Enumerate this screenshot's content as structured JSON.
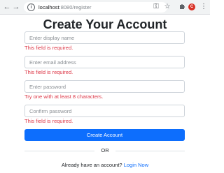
{
  "browser": {
    "url_host": "localhost",
    "url_rest": ":8080/register",
    "back_glyph": "←",
    "forward_glyph": "→",
    "reload_glyph": "↻",
    "info_glyph": "i",
    "key_glyph": "⚿",
    "star_glyph": "☆",
    "extension_glyph": "C",
    "menu_glyph": "⋮",
    "icons": [
      "back-icon",
      "forward-icon",
      "reload-icon",
      "info-icon",
      "key-icon",
      "star-icon",
      "extension-icon",
      "profile-icon",
      "menu-icon"
    ]
  },
  "form": {
    "title": "Create Your Account",
    "fields": [
      {
        "placeholder": "Enter display name",
        "value": "",
        "error": "This field is required."
      },
      {
        "placeholder": "Enter email address",
        "value": "",
        "error": "This field is required."
      },
      {
        "placeholder": "Enter password",
        "value": "",
        "error": "Try one with at least 8 characters."
      },
      {
        "placeholder": "Confirm password",
        "value": "",
        "error": "This field is required."
      }
    ],
    "submit_label": "Create Account",
    "divider_text": "OR",
    "login_prompt": "Already have an account?",
    "login_link": "Login Now"
  },
  "colors": {
    "primary": "#0d6efd",
    "error": "#dc3545",
    "border": "#ced4da"
  }
}
